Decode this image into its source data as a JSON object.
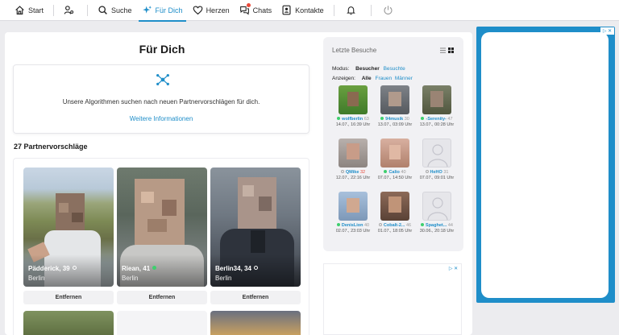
{
  "nav": {
    "items": [
      {
        "label": "Start",
        "icon": "home-icon"
      },
      {
        "label": "",
        "icon": "user-settings-icon"
      },
      {
        "label": "Suche",
        "icon": "search-icon"
      },
      {
        "label": "Für Dich",
        "icon": "sparkle-icon",
        "active": true
      },
      {
        "label": "Herzen",
        "icon": "heart-icon"
      },
      {
        "label": "Chats",
        "icon": "chat-icon"
      },
      {
        "label": "Kontakte",
        "icon": "contacts-icon"
      },
      {
        "label": "",
        "icon": "bell-icon"
      },
      {
        "label": "",
        "icon": "power-icon"
      }
    ]
  },
  "main": {
    "title": "Für Dich",
    "algo_text": "Unsere Algorithmen suchen nach neuen Partnervorschlägen für dich.",
    "algo_link": "Weitere Informationen",
    "count_title": "27 Partnervorschläge",
    "remove_label": "Entfernen",
    "cards": [
      {
        "name": "Pädderick",
        "age": "39",
        "city": "Berlin",
        "online": false
      },
      {
        "name": "Riean",
        "age": "41",
        "city": "Berlin",
        "online": true
      },
      {
        "name": "Berlin34",
        "age": "34",
        "city": "Berlin",
        "online": false
      }
    ]
  },
  "visits": {
    "title": "Letzte Besuche",
    "modus_label": "Modus:",
    "modus_options": [
      "Besucher",
      "Besuchte"
    ],
    "anzeigen_label": "Anzeigen:",
    "anzeigen_options": [
      "Alle",
      "Frauen",
      "Männer"
    ],
    "people": [
      {
        "name": "wolfberlin",
        "age": "63",
        "date": "14.07., 16:39 Uhr",
        "online": true
      },
      {
        "name": "94musik",
        "age": "30",
        "date": "13.07., 03:09 Uhr",
        "online": true
      },
      {
        "name": "-Serenity-",
        "age": "47",
        "date": "13.07., 00:28 Uhr",
        "online": true
      },
      {
        "name": "QMike",
        "age": "32",
        "date": "12.07., 22:16 Uhr",
        "online": false
      },
      {
        "name": "Calio",
        "age": "40",
        "date": "07.07., 14:50 Uhr",
        "online": true
      },
      {
        "name": "HeHO",
        "age": "31",
        "date": "07.07., 09:01 Uhr",
        "online": false
      },
      {
        "name": "DenisLion",
        "age": "40",
        "date": "02.07., 23:03 Uhr",
        "online": true
      },
      {
        "name": "Cobalt-2...",
        "age": "46",
        "date": "01.07., 18:05 Uhr",
        "online": false
      },
      {
        "name": "Spaghet...",
        "age": "44",
        "date": "30.06., 20:18 Uhr",
        "online": true
      }
    ]
  },
  "ads": {
    "mark": "▷ ✕"
  },
  "colors": {
    "accent": "#1f8ec9",
    "online": "#3ecf6e",
    "ad_frame": "#1f8ec9"
  }
}
